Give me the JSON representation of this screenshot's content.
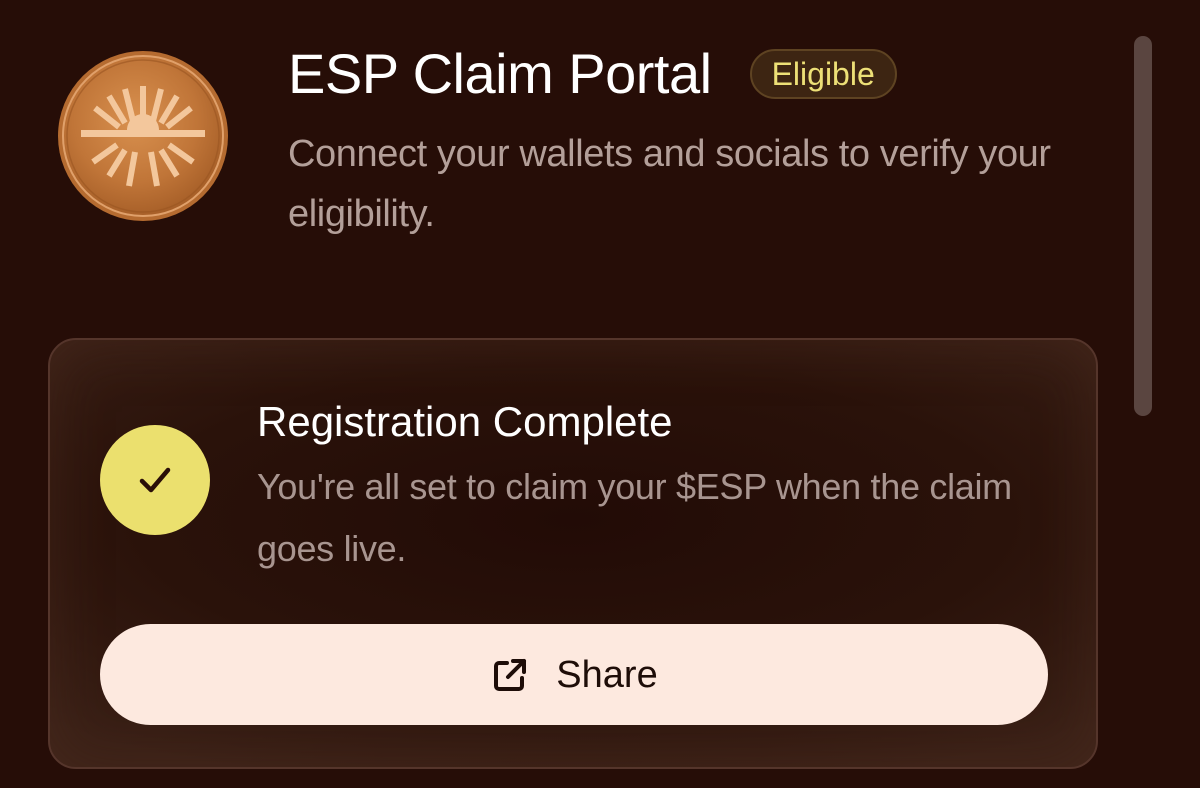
{
  "header": {
    "title": "ESP Claim Portal",
    "badge": "Eligible",
    "subtitle": "Connect your wallets and socials to verify your eligibility."
  },
  "registration_card": {
    "title": "Registration Complete",
    "description": "You're all set to claim your $ESP when the claim goes live.",
    "status_icon": "checkmark-icon",
    "share_button": {
      "label": "Share",
      "icon": "external-link-icon"
    }
  },
  "logo": {
    "icon": "esp-sunburst-coin",
    "color": "#c77b3f"
  },
  "colors": {
    "background": "#260d07",
    "badge_text": "#ede077",
    "check_circle": "#ebe06e",
    "button_bg": "#fde9df"
  }
}
